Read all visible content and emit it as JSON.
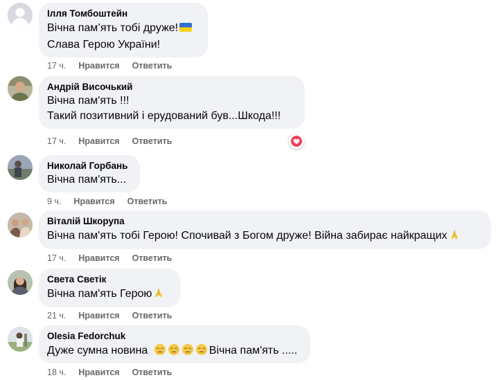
{
  "colors": {
    "bubble": "#f0f2f5",
    "meta_text": "#65676b",
    "text": "#050505",
    "love_reaction": "#f33e58"
  },
  "comments": [
    {
      "author": "Ілля Томбоштейн",
      "lines": [
        "Вічна пам’ять тобі друже!",
        "Слава Герою України!"
      ],
      "emoji": "ukraine-flag-icon",
      "time": "17 ч.",
      "like_label": "Нравится",
      "reply_label": "Ответить"
    },
    {
      "author": "Андрій Височький",
      "lines": [
        "Вічна пам'ять !!!",
        "Такий позитивний і ерудований був...Шкода!!!"
      ],
      "time": "17 ч.",
      "like_label": "Нравится",
      "reply_label": "Ответить",
      "reaction": "love-reaction-icon"
    },
    {
      "author": "Николай Горбань",
      "lines": [
        "Вічна пам'ять..."
      ],
      "time": "9 ч.",
      "like_label": "Нравится",
      "reply_label": "Ответить"
    },
    {
      "author": "Віталій Шкорупа",
      "lines": [
        "Вічна пам'ять тобі Герою! Спочивай з Богом друже! Війна забирає найкращих"
      ],
      "emoji": "folded-hands-icon",
      "time": "17 ч.",
      "like_label": "Нравится",
      "reply_label": "Ответить"
    },
    {
      "author": "Света Светік",
      "lines": [
        "Вічна пам'ять Герою"
      ],
      "emoji": "folded-hands-icon",
      "time": "21 ч.",
      "like_label": "Нравится",
      "reply_label": "Ответить"
    },
    {
      "author": "Olesia Fedorchuk",
      "lines": [
        "Дуже сумна новина",
        "Вічна пам'ять ....."
      ],
      "emoji": "sad-face-icon",
      "time": "18 ч.",
      "like_label": "Нравится",
      "reply_label": "Ответить"
    }
  ]
}
